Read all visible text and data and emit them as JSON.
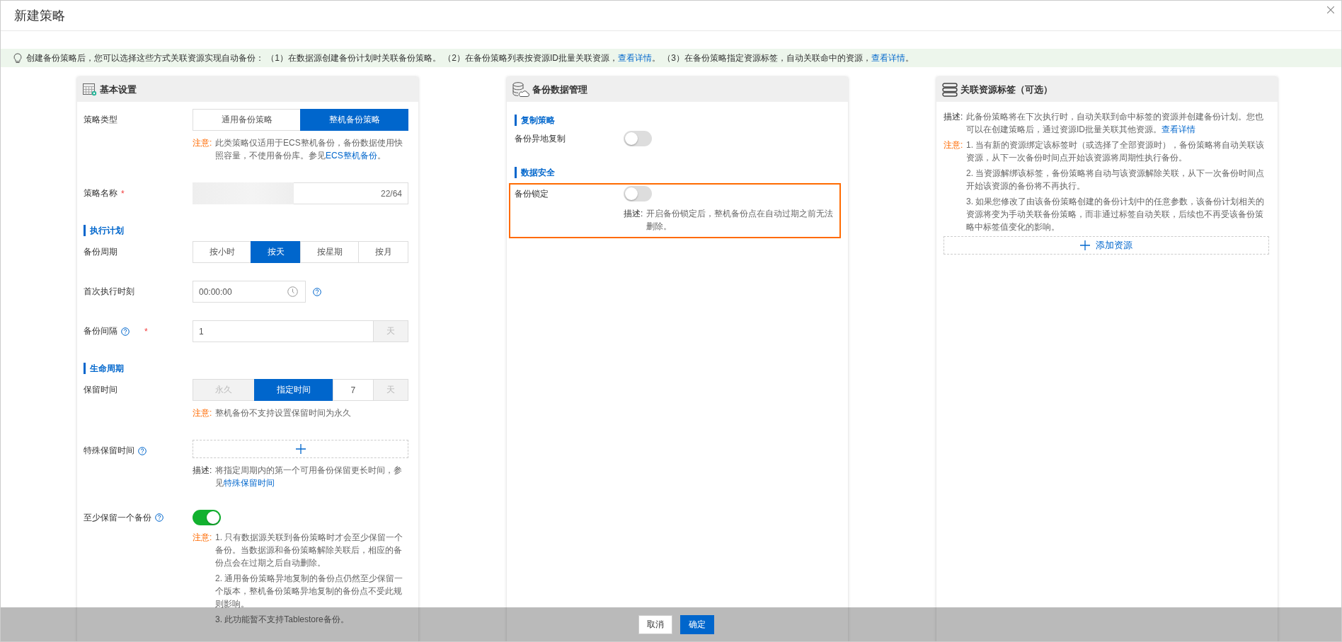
{
  "dialog": {
    "title": "新建策略"
  },
  "banner": {
    "segments": [
      {
        "kind": "text",
        "text": "创建备份策略后，您可以选择这些方式关联资源实现自动备份： （1）在数据源创建备份计划时关联备份策略。 （2）在备份策略列表按资源ID批量关联资源，"
      },
      {
        "kind": "link",
        "text": "查看详情"
      },
      {
        "kind": "text",
        "text": "。 （3）在备份策略指定资源标签，自动关联命中的资源，"
      },
      {
        "kind": "link",
        "text": "查看详情"
      },
      {
        "kind": "text",
        "text": "。"
      }
    ]
  },
  "panels": [
    {
      "title": "基本设置",
      "items": [
        {
          "kind": "row",
          "label": "策略类型",
          "control": {
            "kind": "segmented",
            "options": [
              {
                "label": "通用备份策略",
                "selected": false,
                "disabled": false
              },
              {
                "label": "整机备份策略",
                "selected": true,
                "disabled": false
              }
            ]
          },
          "notes": [
            {
              "kind": "warning",
              "prefix": "注意:",
              "paragraphs": [
                [
                  {
                    "kind": "text",
                    "text": "此类策略仅适用于ECS整机备份，备份数据使用快照容量，不使用备份库。参见"
                  },
                  {
                    "kind": "link",
                    "text": "ECS整机备份"
                  },
                  {
                    "kind": "text",
                    "text": "。"
                  }
                ]
              ]
            }
          ]
        },
        {
          "kind": "row",
          "label": "策略名称",
          "required_mark": "*",
          "control": {
            "kind": "text_input",
            "redacted": true,
            "counter": "22/64"
          }
        },
        {
          "kind": "section",
          "title": "执行计划"
        },
        {
          "kind": "row",
          "label": "备份周期",
          "control": {
            "kind": "segmented",
            "options": [
              {
                "label": "按小时",
                "selected": false,
                "disabled": false
              },
              {
                "label": "按天",
                "selected": true,
                "disabled": false
              },
              {
                "label": "按星期",
                "selected": false,
                "disabled": false
              },
              {
                "label": "按月",
                "selected": false,
                "disabled": false
              }
            ]
          }
        },
        {
          "kind": "row",
          "label": "首次执行时刻",
          "control": {
            "kind": "time_input",
            "value": "00:00:00"
          },
          "control_help": true
        },
        {
          "kind": "row",
          "label": "备份间隔",
          "label_help": true,
          "required_mark": "*",
          "control": {
            "kind": "text_input",
            "value": "1",
            "addon": "天"
          }
        },
        {
          "kind": "section",
          "title": "生命周期"
        },
        {
          "kind": "row",
          "label": "保留时间",
          "control": {
            "kind": "segmented",
            "options": [
              {
                "label": "永久",
                "selected": false,
                "disabled": true
              },
              {
                "label": "指定时间",
                "selected": true,
                "disabled": false
              }
            ],
            "value": "7",
            "addon": "天"
          },
          "notes": [
            {
              "kind": "warning",
              "prefix": "注意:",
              "paragraphs": [
                [
                  {
                    "kind": "text",
                    "text": "整机备份不支持设置保留时间为永久"
                  }
                ]
              ]
            }
          ]
        },
        {
          "kind": "row",
          "label": "特殊保留时间",
          "label_help": true,
          "control": {
            "kind": "add_box"
          },
          "notes": [
            {
              "kind": "info",
              "prefix": "描述:",
              "paragraphs": [
                [
                  {
                    "kind": "text",
                    "text": "将指定周期内的第一个可用备份保留更长时间，参见"
                  },
                  {
                    "kind": "link",
                    "text": "特殊保留时间"
                  }
                ]
              ]
            }
          ]
        },
        {
          "kind": "row",
          "label": "至少保留一个备份",
          "label_help": true,
          "control": {
            "kind": "toggle",
            "on": true
          },
          "notes": [
            {
              "kind": "warning",
              "prefix": "注意:",
              "paragraphs": [
                [
                  {
                    "kind": "text",
                    "text": "1. 只有数据源关联到备份策略时才会至少保留一个备份。当数据源和备份策略解除关联后，相应的备份点会在过期之后自动删除。"
                  }
                ],
                [
                  {
                    "kind": "text",
                    "text": "2. 通用备份策略异地复制的备份点仍然至少保留一个版本，整机备份策略异地复制的备份点不受此规则影响。"
                  }
                ],
                [
                  {
                    "kind": "text",
                    "text": "3. 此功能暂不支持Tablestore备份。"
                  }
                ]
              ]
            }
          ]
        }
      ]
    },
    {
      "title": "备份数据管理",
      "items": [
        {
          "kind": "section",
          "title": "复制策略"
        },
        {
          "kind": "row",
          "label": "备份异地复制",
          "control": {
            "kind": "toggle",
            "on": false
          }
        },
        {
          "kind": "section",
          "title": "数据安全"
        },
        {
          "kind": "row",
          "label": "备份锁定",
          "highlighted": true,
          "control": {
            "kind": "toggle",
            "on": false
          },
          "notes": [
            {
              "kind": "info",
              "prefix": "描述:",
              "paragraphs": [
                [
                  {
                    "kind": "text",
                    "text": "开启备份锁定后，整机备份点在自动过期之前无法删除。"
                  }
                ]
              ]
            }
          ]
        }
      ]
    },
    {
      "title": "关联资源标签（可选）",
      "items": [
        {
          "kind": "note",
          "note": {
            "kind": "info",
            "prefix": "描述:",
            "paragraphs": [
              [
                {
                  "kind": "text",
                  "text": "此备份策略将在下次执行时，自动关联到命中标签的资源并创建备份计划。您也可以在创建策略后，通过资源ID批量关联其他资源。"
                },
                {
                  "kind": "link",
                  "text": "查看详情"
                }
              ]
            ]
          }
        },
        {
          "kind": "note",
          "note": {
            "kind": "warning",
            "prefix": "注意:",
            "paragraphs": [
              [
                {
                  "kind": "text",
                  "text": "1. 当有新的资源绑定该标签时（或选择了全部资源时），备份策略将自动关联该资源，从下一次备份时间点开始该资源将周期性执行备份。"
                }
              ],
              [
                {
                  "kind": "text",
                  "text": "2. 当资源解绑该标签，备份策略将自动与该资源解除关联，从下一次备份时间点开始该资源的备份将不再执行。"
                }
              ],
              [
                {
                  "kind": "text",
                  "text": "3. 如果您修改了由该备份策略创建的备份计划中的任意参数，该备份计划相关的资源将变为手动关联备份策略，而非通过标签自动关联，后续也不再受该备份策略中标签值变化的影响。"
                }
              ]
            ]
          }
        },
        {
          "kind": "add_button",
          "label": "添加资源"
        }
      ]
    }
  ],
  "footer": {
    "buttons": [
      {
        "label": "取消",
        "kind": "default"
      },
      {
        "label": "确定",
        "kind": "primary"
      }
    ]
  }
}
